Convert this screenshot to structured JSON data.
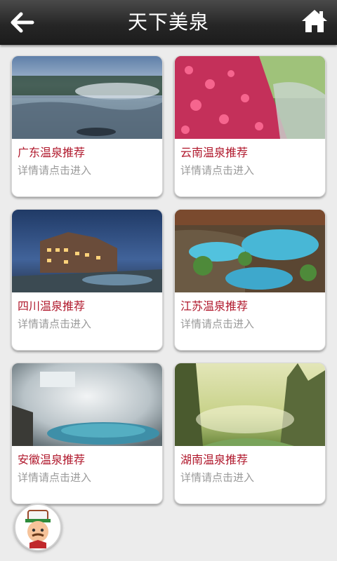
{
  "header": {
    "title": "天下美泉",
    "back_icon": "arrow-left-icon",
    "home_icon": "home-icon"
  },
  "cards": [
    {
      "title": "广东温泉推荐",
      "subtitle": "详情请点击进入"
    },
    {
      "title": "云南温泉推荐",
      "subtitle": "详情请点击进入"
    },
    {
      "title": "四川温泉推荐",
      "subtitle": "详情请点击进入"
    },
    {
      "title": "江苏温泉推荐",
      "subtitle": "详情请点击进入"
    },
    {
      "title": "安徽温泉推荐",
      "subtitle": "详情请点击进入"
    },
    {
      "title": "湖南温泉推荐",
      "subtitle": "详情请点击进入"
    }
  ],
  "colors": {
    "accent_title": "#b0182c",
    "subtitle": "#9a9a9a",
    "topbar": "#2b2b2b"
  },
  "floating": {
    "icon": "chef-avatar-icon"
  }
}
